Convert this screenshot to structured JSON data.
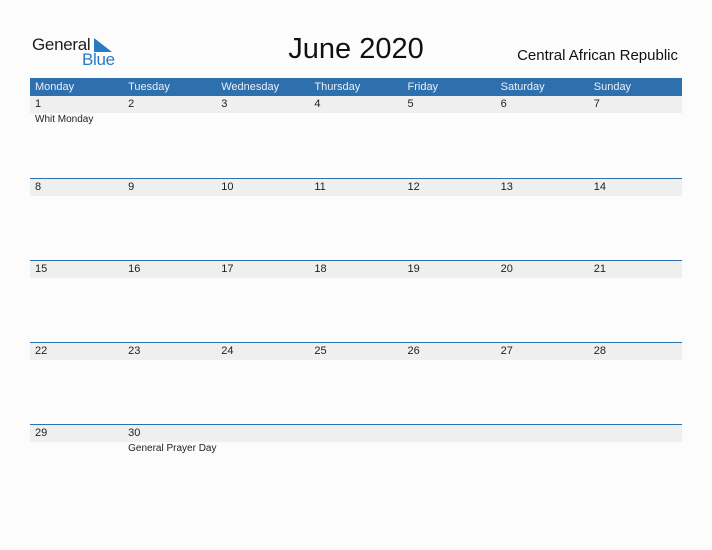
{
  "logo": {
    "word1": "General",
    "word2": "Blue"
  },
  "title": "June 2020",
  "country": "Central African Republic",
  "colors": {
    "header": "#2e6fae",
    "accent": "#2a7bc4",
    "strip": "#efefef"
  },
  "weekdays": [
    "Monday",
    "Tuesday",
    "Wednesday",
    "Thursday",
    "Friday",
    "Saturday",
    "Sunday"
  ],
  "weeks": [
    {
      "days": [
        "1",
        "2",
        "3",
        "4",
        "5",
        "6",
        "7"
      ],
      "events": [
        "Whit Monday",
        "",
        "",
        "",
        "",
        "",
        ""
      ]
    },
    {
      "days": [
        "8",
        "9",
        "10",
        "11",
        "12",
        "13",
        "14"
      ],
      "events": [
        "",
        "",
        "",
        "",
        "",
        "",
        ""
      ]
    },
    {
      "days": [
        "15",
        "16",
        "17",
        "18",
        "19",
        "20",
        "21"
      ],
      "events": [
        "",
        "",
        "",
        "",
        "",
        "",
        ""
      ]
    },
    {
      "days": [
        "22",
        "23",
        "24",
        "25",
        "26",
        "27",
        "28"
      ],
      "events": [
        "",
        "",
        "",
        "",
        "",
        "",
        ""
      ]
    },
    {
      "days": [
        "29",
        "30",
        "",
        "",
        "",
        "",
        ""
      ],
      "events": [
        "",
        "General Prayer Day",
        "",
        "",
        "",
        "",
        ""
      ]
    }
  ]
}
